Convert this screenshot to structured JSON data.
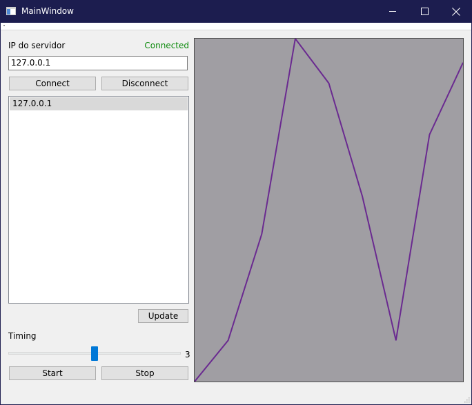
{
  "window": {
    "title": "MainWindow",
    "icon": "app-window-icon",
    "controls": [
      "minimize-icon",
      "maximize-icon",
      "close-icon"
    ],
    "titlebar_color": "#1c1d4f"
  },
  "connection": {
    "server_ip_label": "IP do servidor",
    "status": "Connected",
    "status_color": "#0b8a0b",
    "ip_value": "127.0.0.1",
    "connect_label": "Connect",
    "disconnect_label": "Disconnect"
  },
  "server_list": {
    "items": [
      {
        "label": "127.0.0.1",
        "selected": true
      }
    ]
  },
  "update_label": "Update",
  "timing": {
    "label": "Timing",
    "value": "3",
    "slider_fraction": 0.5
  },
  "start_label": "Start",
  "stop_label": "Stop",
  "chart_data": {
    "type": "line",
    "grid": false,
    "background": "#a09ea3",
    "series": [
      {
        "color": "#6a2a90",
        "values": [
          0.0,
          0.12,
          0.43,
          1.0,
          0.87,
          0.54,
          0.12,
          0.72,
          0.93
        ]
      }
    ],
    "ylim": [
      0,
      1
    ]
  }
}
